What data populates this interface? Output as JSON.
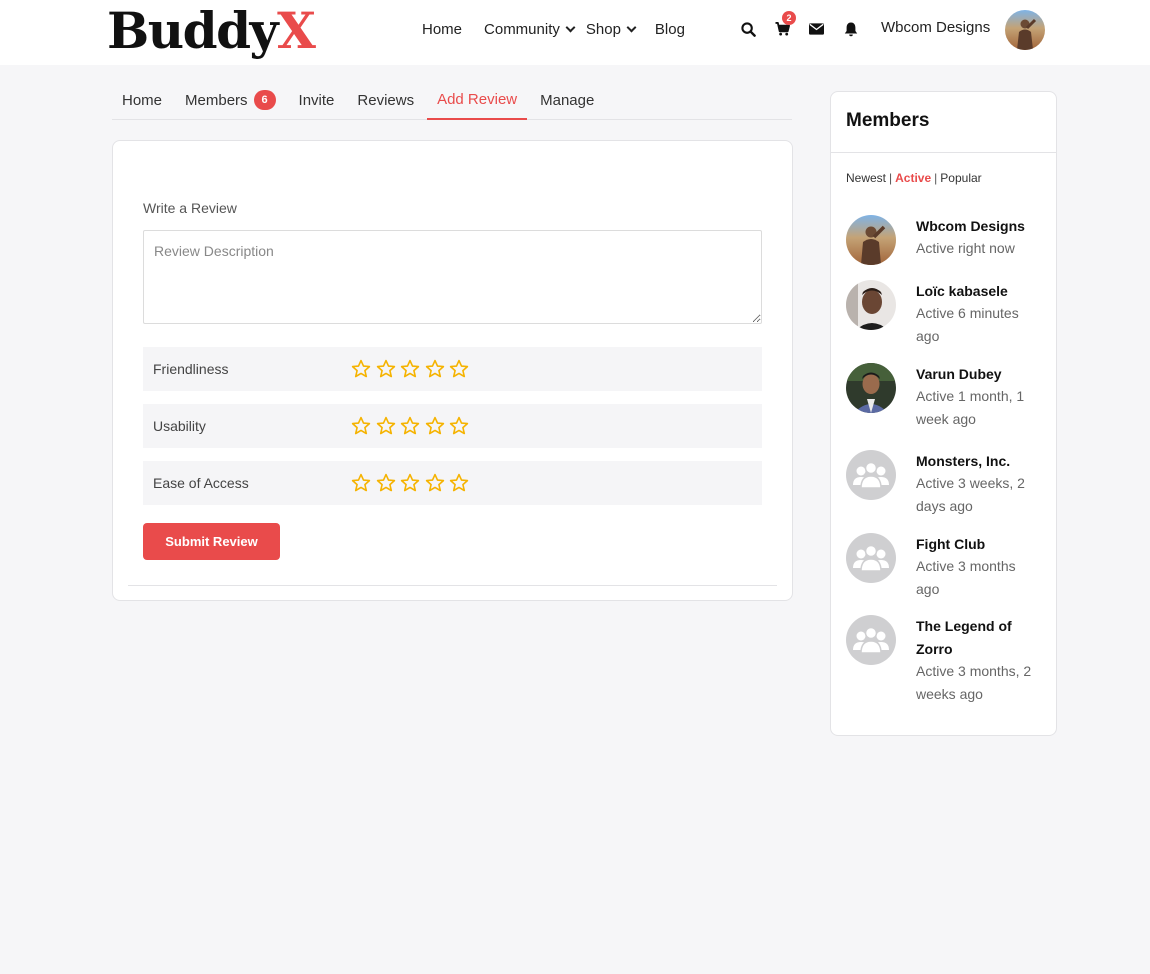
{
  "header": {
    "logo_main": "Buddy",
    "logo_accent": "X",
    "nav": [
      {
        "label": "Home"
      },
      {
        "label": "Community"
      },
      {
        "label": "Shop"
      },
      {
        "label": "Blog"
      }
    ],
    "cart_count": "2",
    "user_name": "Wbcom Designs"
  },
  "tabs": [
    {
      "label": "Home"
    },
    {
      "label": "Members",
      "badge": "6"
    },
    {
      "label": "Invite"
    },
    {
      "label": "Reviews"
    },
    {
      "label": "Add Review"
    },
    {
      "label": "Manage"
    }
  ],
  "review_form": {
    "write_label": "Write a Review",
    "description_placeholder": "Review Description",
    "criteria": [
      {
        "label": "Friendliness",
        "rating": 0,
        "max": 5
      },
      {
        "label": "Usability",
        "rating": 0,
        "max": 5
      },
      {
        "label": "Ease of Access",
        "rating": 0,
        "max": 5
      }
    ],
    "submit_label": "Submit Review"
  },
  "members_widget": {
    "title": "Members",
    "filters": [
      {
        "label": "Newest"
      },
      {
        "label": "Active"
      },
      {
        "label": "Popular"
      }
    ],
    "filter_separator": "|",
    "active_filter": "Active",
    "members": [
      {
        "name": "Wbcom Designs",
        "status": "Active right now"
      },
      {
        "name": "Loïc kabasele",
        "status": "Active 6 minutes ago"
      },
      {
        "name": "Varun Dubey",
        "status": "Active 1 month, 1 week ago"
      },
      {
        "name": "Monsters, Inc.",
        "status": "Active 3 weeks, 2 days ago"
      },
      {
        "name": "Fight Club",
        "status": "Active 3 months ago"
      },
      {
        "name": "The Legend of Zorro",
        "status": "Active 3 months, 2 weeks ago"
      }
    ]
  },
  "colors": {
    "accent": "#e94b4b",
    "star": "#f5b301",
    "background": "#f6f6f8"
  }
}
